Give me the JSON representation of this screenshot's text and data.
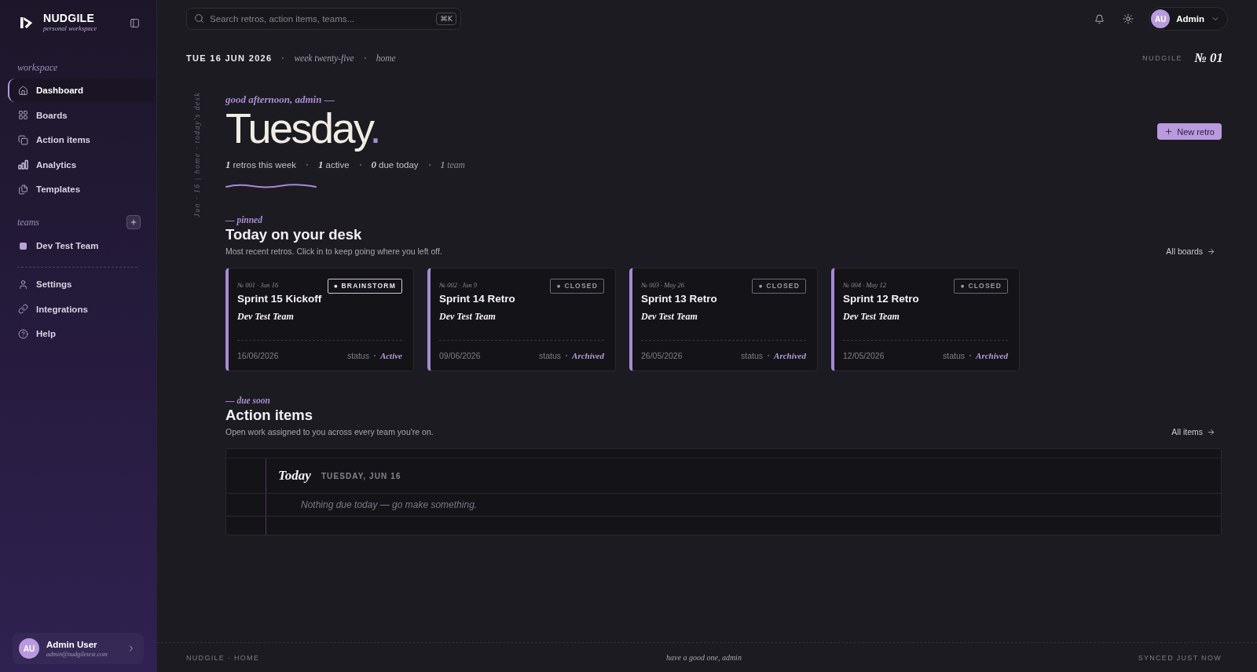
{
  "sidebar": {
    "brand": {
      "name": "NUDGILE",
      "subtitle": "personal workspace"
    },
    "nav": {
      "label": "workspace",
      "items": [
        {
          "label": "Dashboard",
          "selected": true
        },
        {
          "label": "Boards",
          "selected": false
        },
        {
          "label": "Action items",
          "selected": false
        },
        {
          "label": "Analytics",
          "selected": false
        },
        {
          "label": "Templates",
          "selected": false
        }
      ]
    },
    "teams": {
      "label": "teams",
      "items": [
        {
          "label": "Dev Test Team",
          "selected": false,
          "color": "#b8a2da"
        }
      ]
    },
    "bottom_nav": [
      {
        "label": "Settings",
        "selected": false
      },
      {
        "label": "Integrations",
        "selected": false
      },
      {
        "label": "Help",
        "selected": false
      }
    ],
    "user": {
      "initials": "AU",
      "name": "Admin User",
      "email": "admin@nudgiletest.com"
    }
  },
  "topbar": {
    "search": {
      "placeholder": "Search retros, action items, teams...",
      "shortcut": "⌘K"
    },
    "user": {
      "initials": "AU",
      "name": "Admin"
    }
  },
  "dateline": {
    "date": "TUE 16 JUN 2026",
    "week": "week twenty-five",
    "place": "home",
    "brand": "NUDGILE",
    "issue": "№ 01"
  },
  "margin_note": "Jun · 16 | home · today's desk",
  "hero": {
    "greeting": "good afternoon, admin —",
    "day": "Tuesday",
    "accent": ".",
    "stats": [
      {
        "kind": "count",
        "value": "1",
        "label": "retros this week"
      },
      {
        "kind": "count",
        "value": "1",
        "label": "active"
      },
      {
        "kind": "count",
        "value": "0",
        "label": "due today"
      },
      {
        "kind": "note",
        "value": "1",
        "label": "team"
      }
    ],
    "button": "New retro"
  },
  "pinned": {
    "eyebrow": "— pinned",
    "title": "Today on your desk",
    "subtitle": "Most recent retros. Click in to keep going where you left off.",
    "link": "All boards",
    "cards": [
      {
        "number": "№ 001 · Jun 16",
        "badge": {
          "kind": "brainstorm",
          "label": "● BRAINSTORM"
        },
        "title": "Sprint 15 Kickoff",
        "team": "Dev Test Team",
        "date": "16/06/2026",
        "status_label": "status",
        "status": "Active"
      },
      {
        "number": "№ 002 · Jun 9",
        "badge": {
          "kind": "closed",
          "label": "● CLOSED"
        },
        "title": "Sprint 14 Retro",
        "team": "Dev Test Team",
        "date": "09/06/2026",
        "status_label": "status",
        "status": "Archived"
      },
      {
        "number": "№ 003 · May 26",
        "badge": {
          "kind": "closed",
          "label": "● CLOSED"
        },
        "title": "Sprint 13 Retro",
        "team": "Dev Test Team",
        "date": "26/05/2026",
        "status_label": "status",
        "status": "Archived"
      },
      {
        "number": "№ 004 · May 12",
        "badge": {
          "kind": "closed",
          "label": "● CLOSED"
        },
        "title": "Sprint 12 Retro",
        "team": "Dev Test Team",
        "date": "12/05/2026",
        "status_label": "status",
        "status": "Archived"
      }
    ]
  },
  "action_items": {
    "eyebrow": "— due soon",
    "title": "Action items",
    "subtitle": "Open work assigned to you across every team you're on.",
    "link": "All items",
    "groups": [
      {
        "day": "Today",
        "date": "TUESDAY, JUN 16",
        "empty": "Nothing due today — go make something."
      }
    ]
  },
  "footer": {
    "left": "NUDGILE · HOME",
    "center": "have a good one, admin",
    "right": "SYNCED JUST NOW"
  }
}
